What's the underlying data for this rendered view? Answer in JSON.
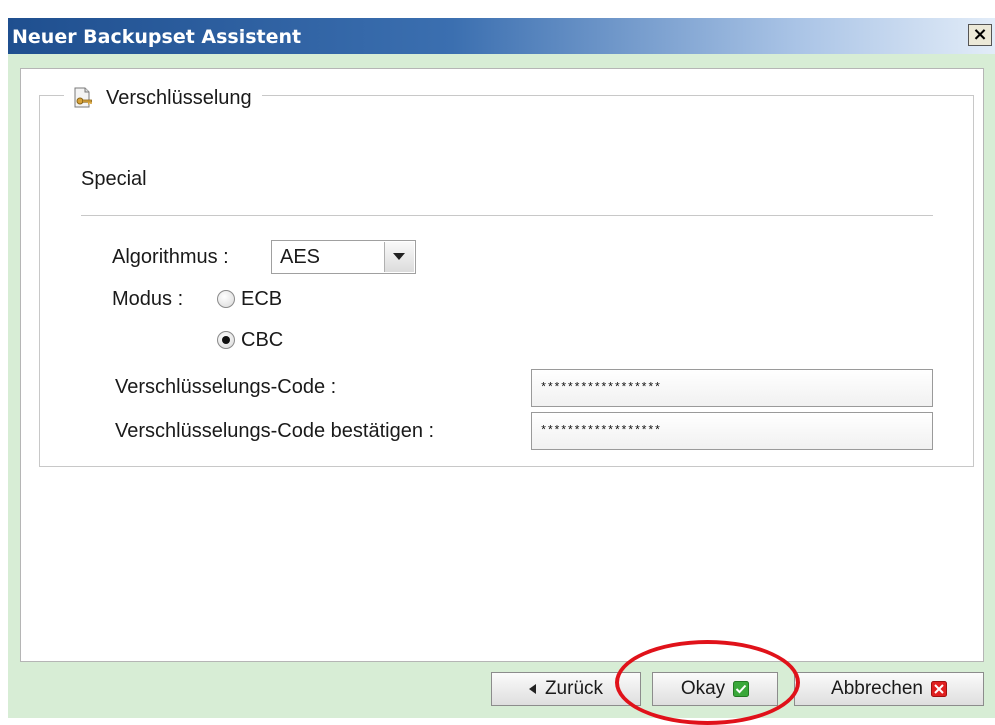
{
  "window": {
    "title": "Neuer Backupset Assistent",
    "close_glyph": "×"
  },
  "section": {
    "legend": "Verschlüsselung",
    "legend_icon": "key-document-icon",
    "subtitle": "Special"
  },
  "algorithm": {
    "label": "Algorithmus :",
    "selected": "AES"
  },
  "mode": {
    "label": "Modus :",
    "options": [
      {
        "label": "ECB",
        "checked": false
      },
      {
        "label": "CBC",
        "checked": true
      }
    ]
  },
  "code": {
    "label": "Verschlüsselungs-Code :",
    "value": "******************"
  },
  "confirm": {
    "label": "Verschlüsselungs-Code bestätigen :",
    "value": "******************"
  },
  "buttons": {
    "back": "Zurück",
    "ok": "Okay",
    "cancel": "Abbrechen"
  },
  "colors": {
    "title_gradient_start": "#1f4f8f",
    "frame_background": "#d7edd5",
    "annotation_circle": "#e0121a",
    "ok_icon": "#3aa83a",
    "cancel_icon": "#e02020"
  }
}
